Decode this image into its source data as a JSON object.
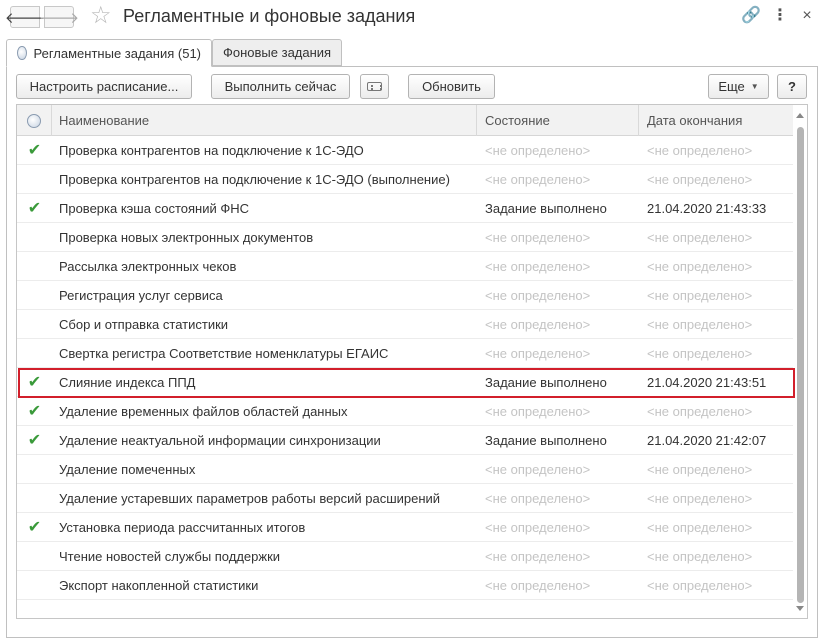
{
  "window": {
    "title": "Регламентные и фоновые задания",
    "back_glyph": "🡐",
    "forward_glyph": "🡒",
    "star_glyph": "☆",
    "link_glyph": "🔗",
    "more_glyph": "⋮",
    "close_glyph": "×"
  },
  "tabs": [
    {
      "label": "Регламентные задания (51)",
      "active": true
    },
    {
      "label": "Фоновые задания",
      "active": false
    }
  ],
  "toolbar": {
    "schedule_label": "Настроить расписание...",
    "run_now_label": "Выполнить сейчас",
    "refresh_label": "Обновить",
    "more_label": "Еще",
    "more_chevron": "▼",
    "help_label": "?"
  },
  "table": {
    "columns": {
      "name": "Наименование",
      "state": "Состояние",
      "date": "Дата окончания"
    },
    "check_glyph": "✔",
    "rows": [
      {
        "checked": true,
        "name": "Проверка контрагентов на подключение к 1С-ЭДО",
        "state": "<не определено>",
        "date": "<не определено>"
      },
      {
        "checked": false,
        "name": "Проверка контрагентов на подключение к 1С-ЭДО (выполнение)",
        "state": "<не определено>",
        "date": "<не определено>"
      },
      {
        "checked": true,
        "name": "Проверка кэша состояний ФНС",
        "state": "Задание выполнено",
        "date": "21.04.2020 21:43:33"
      },
      {
        "checked": false,
        "name": "Проверка новых электронных документов",
        "state": "<не определено>",
        "date": "<не определено>"
      },
      {
        "checked": false,
        "name": "Рассылка электронных чеков",
        "state": "<не определено>",
        "date": "<не определено>"
      },
      {
        "checked": false,
        "name": "Регистрация услуг сервиса",
        "state": "<не определено>",
        "date": "<не определено>"
      },
      {
        "checked": false,
        "name": "Сбор и отправка статистики",
        "state": "<не определено>",
        "date": "<не определено>"
      },
      {
        "checked": false,
        "name": "Свертка регистра Соответствие номенклатуры ЕГАИС",
        "state": "<не определено>",
        "date": "<не определено>"
      },
      {
        "checked": true,
        "name": "Слияние индекса ППД",
        "state": "Задание выполнено",
        "date": "21.04.2020 21:43:51",
        "highlighted": true
      },
      {
        "checked": true,
        "name": "Удаление временных файлов областей данных",
        "state": "<не определено>",
        "date": "<не определено>"
      },
      {
        "checked": true,
        "name": "Удаление неактуальной информации синхронизации",
        "state": "Задание выполнено",
        "date": "21.04.2020 21:42:07"
      },
      {
        "checked": false,
        "name": "Удаление помеченных",
        "state": "<не определено>",
        "date": "<не определено>"
      },
      {
        "checked": false,
        "name": "Удаление устаревших параметров работы версий расширений",
        "state": "<не определено>",
        "date": "<не определено>"
      },
      {
        "checked": true,
        "name": "Установка периода рассчитанных итогов",
        "state": "<не определено>",
        "date": "<не определено>"
      },
      {
        "checked": false,
        "name": "Чтение новостей службы поддержки",
        "state": "<не определено>",
        "date": "<не определено>"
      },
      {
        "checked": false,
        "name": "Экспорт накопленной статистики",
        "state": "<не определено>",
        "date": "<не определено>"
      }
    ]
  },
  "colors": {
    "check": "#3a9a3a",
    "highlight_border": "#d21f2b",
    "undefined_text": "#c4c4c4"
  }
}
